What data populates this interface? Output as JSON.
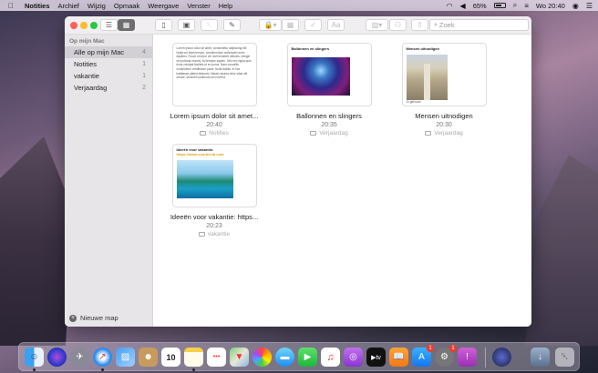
{
  "menubar": {
    "app_name": "Notities",
    "menus": [
      "Archief",
      "Wijzig",
      "Opmaak",
      "Weergave",
      "Venster",
      "Help"
    ],
    "battery": "65%",
    "battery_level": 0.65,
    "clock": "Wo 20:40"
  },
  "toolbar": {
    "search_placeholder": "Zoek",
    "font_button": "Aa"
  },
  "sidebar": {
    "section": "Op mijn Mac",
    "items": [
      {
        "label": "Alle op mijn Mac",
        "count": "4"
      },
      {
        "label": "Notities",
        "count": "1"
      },
      {
        "label": "vakantie",
        "count": "1"
      },
      {
        "label": "Verjaardag",
        "count": "2"
      }
    ],
    "new_folder": "Nieuwe map"
  },
  "notes": [
    {
      "title": "Lorem ipsum dolor sit amet...",
      "time": "20:40",
      "folder": "Notities",
      "preview": "Lorem ipsum dolor sit amet, consectetur adipiscing elit. Nulla vel diam tempor, condimentum sollicitudin enim dapibus. Fusce ut tortor vel nisi hendrerit ultricies. Integer vel pulvinar mauris, eu tempus sapien. Sed nec ligula quis risus volutpat facilisis ut eu purus. Nam convallis consectetur vestibulum porta. Nulla facilisi. In hac habitasse platea dictumst. Mauris lacinia dolor vitae elit ornare, sit amet commodo orci viverra."
    },
    {
      "title": "Ballonnen en slingers",
      "time": "20:35",
      "folder": "Verjaardag",
      "heading": "Ballonnen en slingers"
    },
    {
      "title": "Mensen uitnodigen",
      "time": "20:30",
      "folder": "Verjaardag",
      "heading": "Mensen uitnodigen",
      "caption": "Jo gehoord"
    },
    {
      "title": "Ideeën voor vakantie: https...",
      "time": "20:23",
      "folder": "vakantie",
      "heading": "Ideeën voor vakantie: ",
      "link": "https://www.voorbeeld.com"
    }
  ],
  "dock": [
    "Finder",
    "Siri",
    "Launchpad",
    "Safari",
    "Preview",
    "Contacten",
    "Agenda",
    "Notities",
    "Herinneringen",
    "Kaarten",
    "Foto's",
    "Berichten",
    "FaceTime",
    "Muziek",
    "Podcasts",
    "TV",
    "Boeken",
    "App Store",
    "Systeemvoorkeuren",
    "Feedback-assistent",
    "Downloads",
    "Prullenmand"
  ],
  "dock_calendar_day": "10",
  "dock_badges": {
    "app_store": "1",
    "system_prefs": "1"
  },
  "colors": {
    "accent": "#d9a21c",
    "selected": "#d2d0d4"
  }
}
